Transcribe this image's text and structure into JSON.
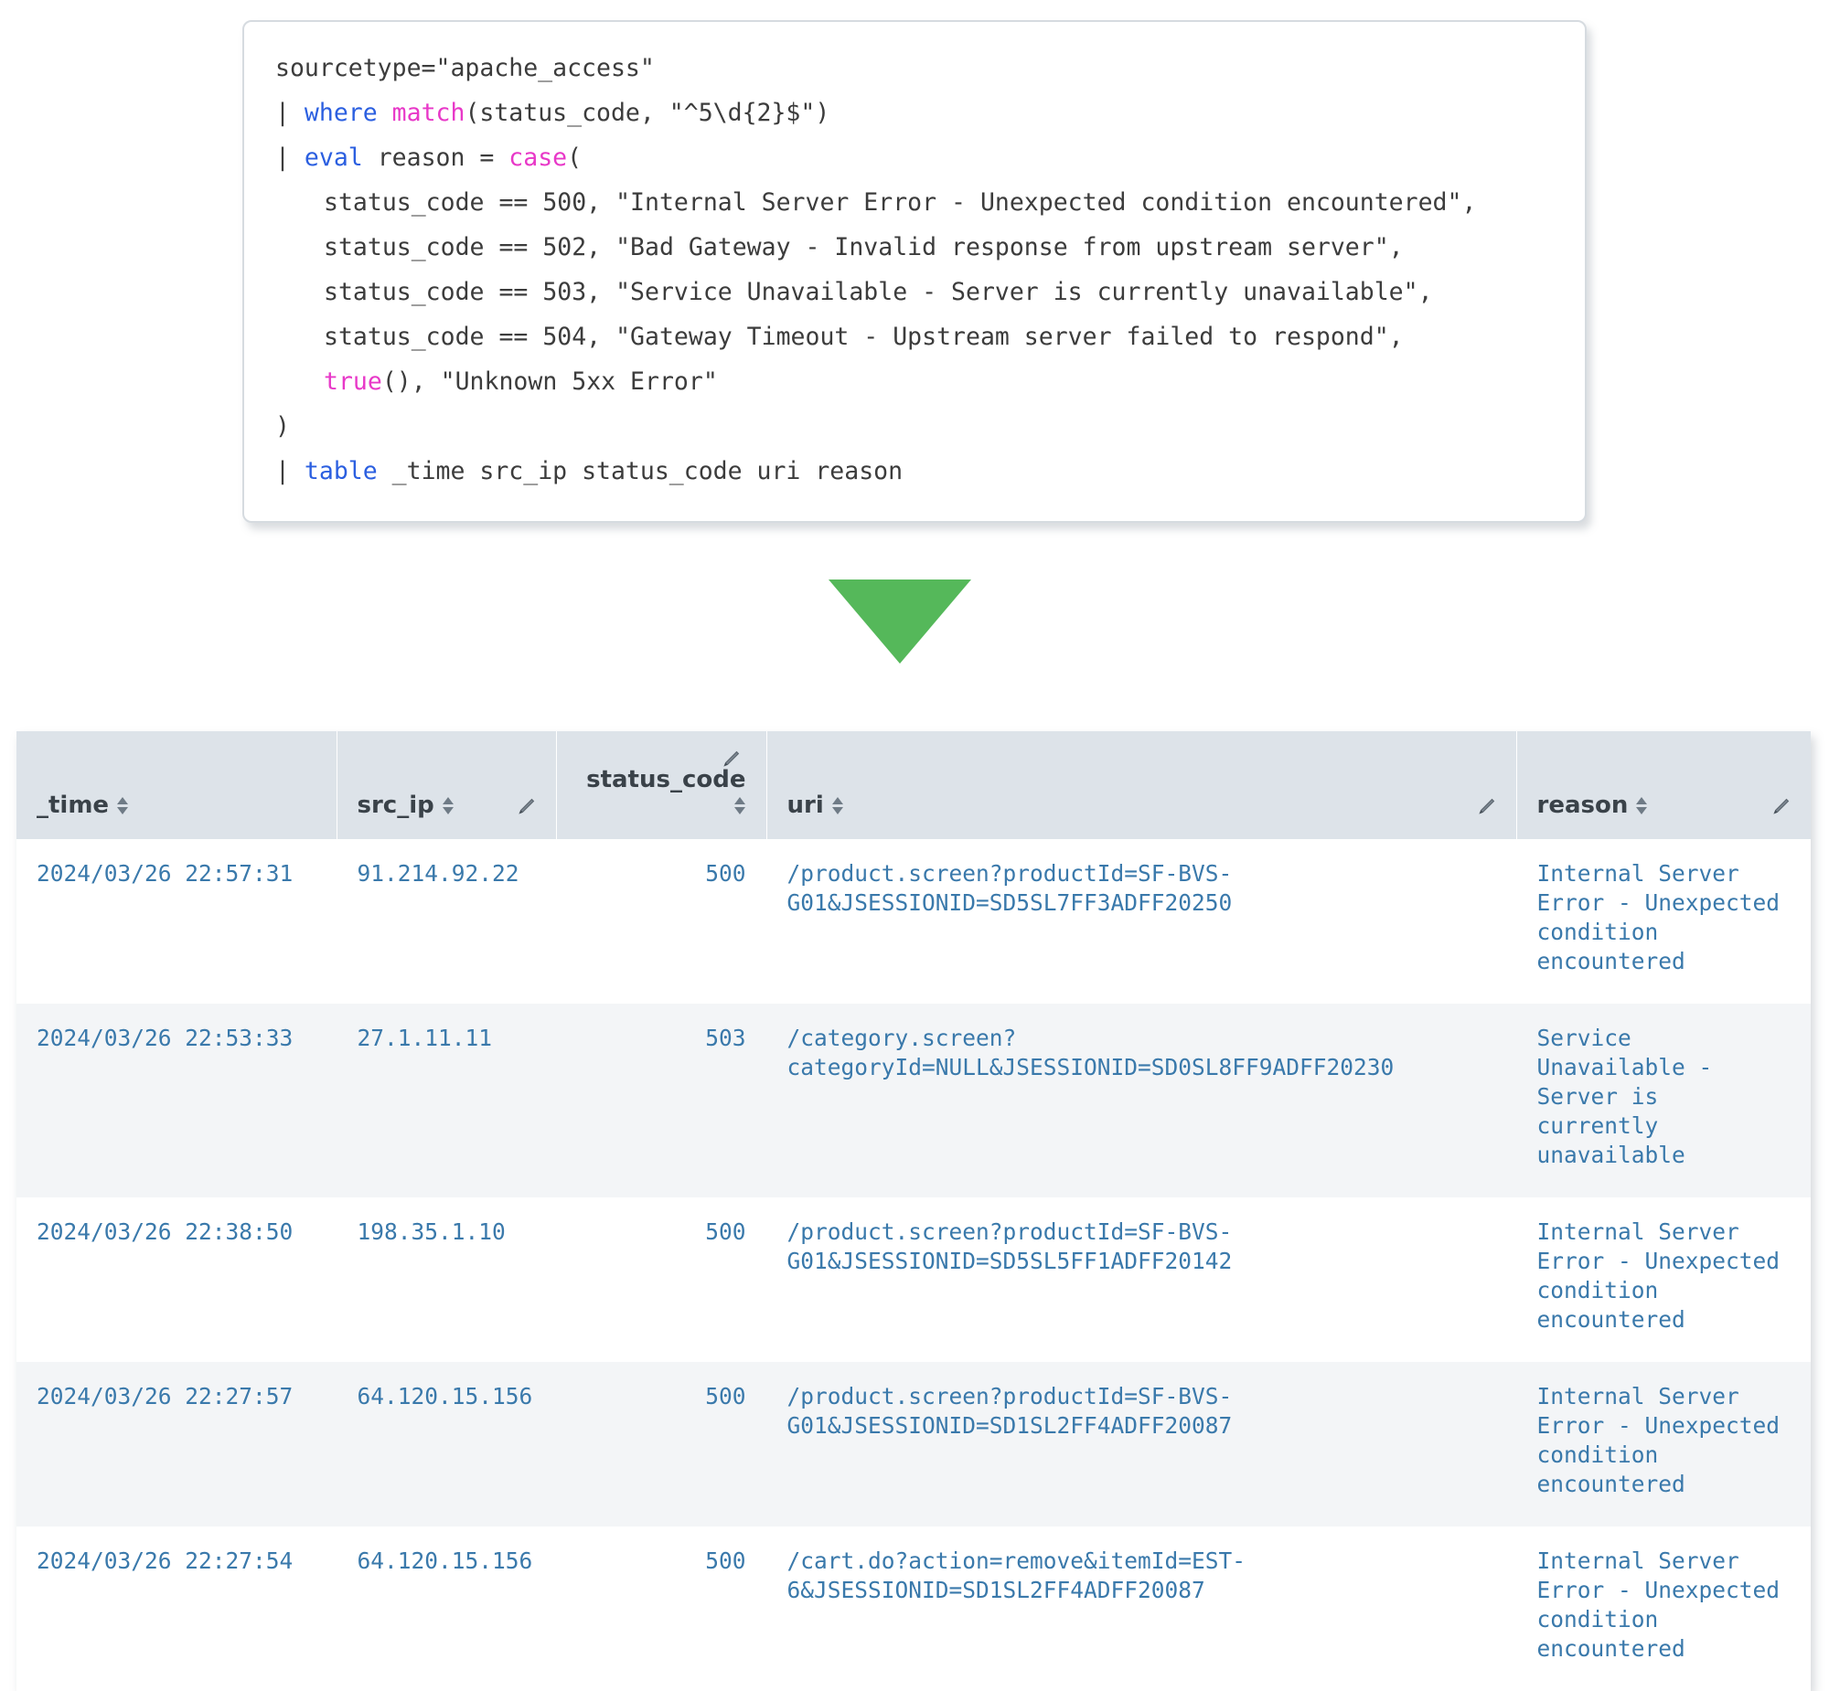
{
  "query": {
    "lines": [
      [
        {
          "t": "sourcetype=\"apache_access\"",
          "c": "plain"
        }
      ],
      [
        {
          "t": "| ",
          "c": "plain"
        },
        {
          "t": "where ",
          "c": "blue"
        },
        {
          "t": "match",
          "c": "pink"
        },
        {
          "t": "(status_code, \"^5\\d{2}$\")",
          "c": "plain"
        }
      ],
      [
        {
          "t": "| ",
          "c": "plain"
        },
        {
          "t": "eval ",
          "c": "blue"
        },
        {
          "t": "reason = ",
          "c": "plain"
        },
        {
          "t": "case",
          "c": "pink"
        },
        {
          "t": "(",
          "c": "plain"
        }
      ],
      [
        {
          "t": "status_code == 500, \"Internal Server Error - Unexpected condition encountered\",",
          "c": "plain",
          "indent": 1
        }
      ],
      [
        {
          "t": "status_code == 502, \"Bad Gateway - Invalid response from upstream server\",",
          "c": "plain",
          "indent": 1
        }
      ],
      [
        {
          "t": "status_code == 503, \"Service Unavailable - Server is currently unavailable\",",
          "c": "plain",
          "indent": 1
        }
      ],
      [
        {
          "t": "status_code == 504, \"Gateway Timeout - Upstream server failed to respond\",",
          "c": "plain",
          "indent": 1
        }
      ],
      [
        {
          "t": "true",
          "c": "pink",
          "indent": 1
        },
        {
          "t": "(), \"Unknown 5xx Error\"",
          "c": "plain"
        }
      ],
      [
        {
          "t": ")",
          "c": "plain"
        }
      ],
      [
        {
          "t": "| ",
          "c": "plain"
        },
        {
          "t": "table ",
          "c": "blue"
        },
        {
          "t": "_time src_ip status_code uri reason",
          "c": "plain"
        }
      ]
    ]
  },
  "arrow": {
    "icon": "triangle-down-icon",
    "color": "#55b85a"
  },
  "results_table": {
    "columns": [
      {
        "key": "_time",
        "label": "_time",
        "align": "left",
        "sortable": true,
        "editable": false
      },
      {
        "key": "src_ip",
        "label": "src_ip",
        "align": "left",
        "sortable": true,
        "editable": true
      },
      {
        "key": "status_code",
        "label": "status_code",
        "align": "right",
        "sortable": true,
        "editable": true
      },
      {
        "key": "uri",
        "label": "uri",
        "align": "left",
        "sortable": true,
        "editable": true
      },
      {
        "key": "reason",
        "label": "reason",
        "align": "left",
        "sortable": true,
        "editable": true
      }
    ],
    "rows": [
      {
        "_time": "2024/03/26 22:57:31",
        "src_ip": "91.214.92.22",
        "status_code": "500",
        "uri": "/product.screen?productId=SF-BVS-G01&JSESSIONID=SD5SL7FF3ADFF20250",
        "reason": "Internal Server Error - Unexpected condition encountered"
      },
      {
        "_time": "2024/03/26 22:53:33",
        "src_ip": "27.1.11.11",
        "status_code": "503",
        "uri": "/category.screen?categoryId=NULL&JSESSIONID=SD0SL8FF9ADFF20230",
        "reason": "Service Unavailable - Server is currently unavailable"
      },
      {
        "_time": "2024/03/26 22:38:50",
        "src_ip": "198.35.1.10",
        "status_code": "500",
        "uri": "/product.screen?productId=SF-BVS-G01&JSESSIONID=SD5SL5FF1ADFF20142",
        "reason": "Internal Server Error - Unexpected condition encountered"
      },
      {
        "_time": "2024/03/26 22:27:57",
        "src_ip": "64.120.15.156",
        "status_code": "500",
        "uri": "/product.screen?productId=SF-BVS-G01&JSESSIONID=SD1SL2FF4ADFF20087",
        "reason": "Internal Server Error - Unexpected condition encountered"
      },
      {
        "_time": "2024/03/26 22:27:54",
        "src_ip": "64.120.15.156",
        "status_code": "500",
        "uri": "/cart.do?action=remove&itemId=EST-6&JSESSIONID=SD1SL2FF4ADFF20087",
        "reason": "Internal Server Error - Unexpected condition encountered"
      }
    ]
  },
  "colors": {
    "header_bg": "#dde3e9",
    "row_alt_bg": "#f3f5f7",
    "link_text": "#3a79ab",
    "keyword_blue": "#2b5fe0",
    "keyword_pink": "#e838c8",
    "arrow_green": "#55b85a"
  }
}
